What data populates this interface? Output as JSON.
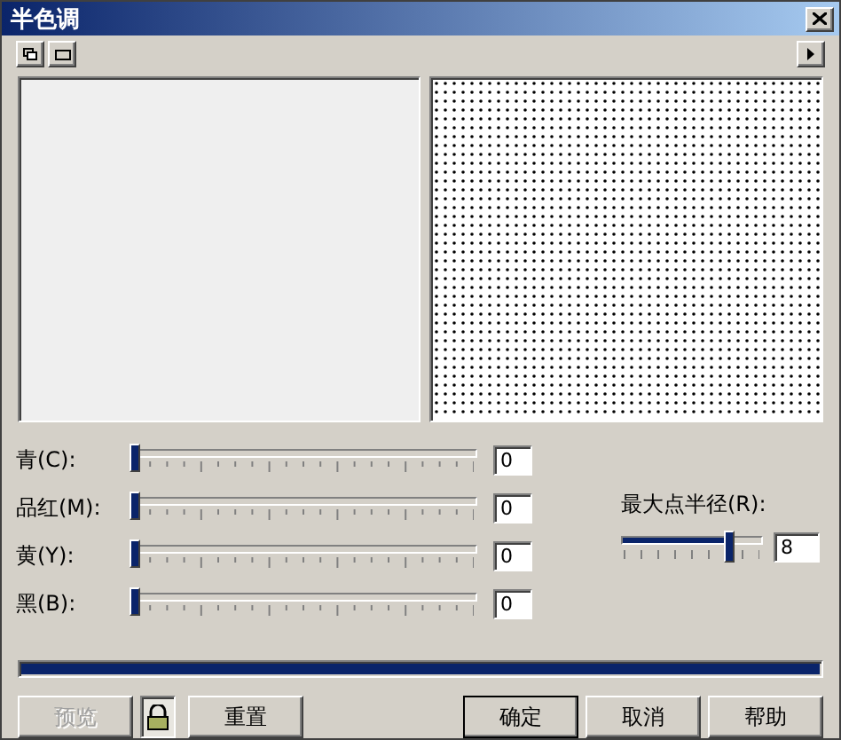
{
  "window": {
    "title": "半色调"
  },
  "channels": [
    {
      "label": "青(C):",
      "level": 0,
      "value": "0"
    },
    {
      "label": "品红(M):",
      "level": 0,
      "value": "0"
    },
    {
      "label": "黄(Y):",
      "level": 0,
      "value": "0"
    },
    {
      "label": "黑(B):",
      "level": 0,
      "value": "0"
    }
  ],
  "radius": {
    "label": "最大点半径(R):",
    "level": 0.78,
    "value": "8"
  },
  "progress": {
    "level": 1
  },
  "buttons": [
    {
      "label": "预览",
      "disabled": true
    },
    {
      "kind": "lock",
      "on": true
    },
    {
      "label": "重置",
      "disabled": false
    },
    {
      "kind": "spacer"
    },
    {
      "label": "确定",
      "default": true,
      "disabled": false
    },
    {
      "label": "取消",
      "disabled": false
    },
    {
      "label": "帮助",
      "disabled": false
    }
  ]
}
